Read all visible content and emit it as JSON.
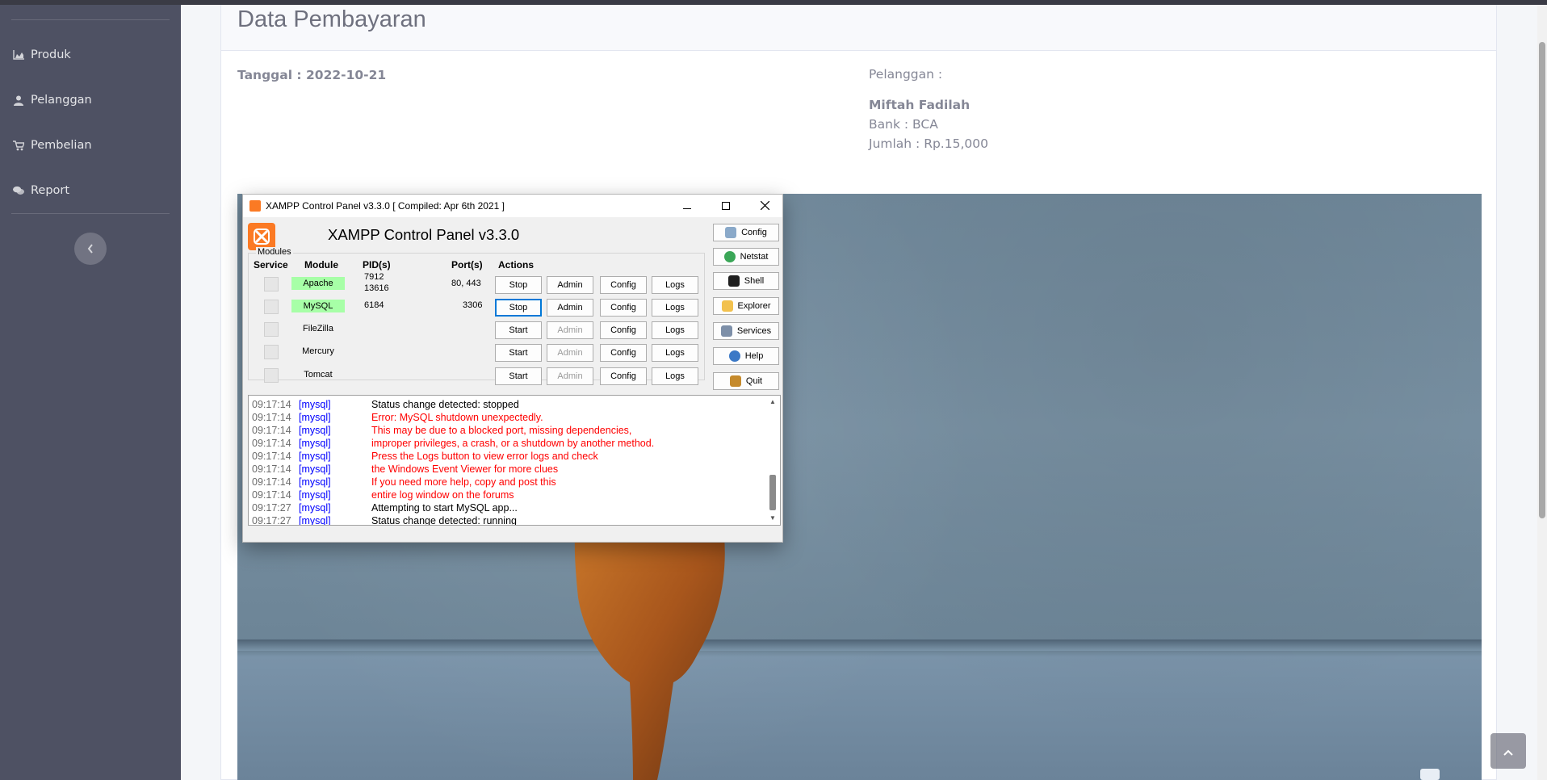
{
  "sidebar": {
    "items": [
      {
        "label": "Produk",
        "icon": "chart-area-icon"
      },
      {
        "label": "Pelanggan",
        "icon": "user-icon"
      },
      {
        "label": "Pembelian",
        "icon": "shopping-cart-icon"
      },
      {
        "label": "Report",
        "icon": "comments-icon"
      }
    ],
    "toggle_icon": "chevron-left-icon"
  },
  "page": {
    "title": "Data Pembayaran",
    "tanggal": "Tanggal : 2022-10-21",
    "customer_label": "Pelanggan :",
    "customer_name": "Miftah Fadilah",
    "bank": "Bank : BCA",
    "jumlah": "Jumlah : Rp.15,000"
  },
  "xampp": {
    "window_title": "XAMPP Control Panel v3.3.0   [ Compiled: Apr 6th 2021 ]",
    "header_title": "XAMPP Control Panel v3.3.0",
    "modules_label": "Modules",
    "columns": {
      "service": "Service",
      "module": "Module",
      "pid": "PID(s)",
      "port": "Port(s)",
      "actions": "Actions"
    },
    "modules": [
      {
        "name": "Apache",
        "pid1": "7912",
        "pid2": "13616",
        "ports": "80, 443",
        "toggle": "Stop",
        "admin": "Admin",
        "config": "Config",
        "logs": "Logs"
      },
      {
        "name": "MySQL",
        "pid1": "6184",
        "pid2": "",
        "ports": "3306",
        "toggle": "Stop",
        "admin": "Admin",
        "config": "Config",
        "logs": "Logs"
      },
      {
        "name": "FileZilla",
        "pid1": "",
        "pid2": "",
        "ports": "",
        "toggle": "Start",
        "admin": "Admin",
        "config": "Config",
        "logs": "Logs"
      },
      {
        "name": "Mercury",
        "pid1": "",
        "pid2": "",
        "ports": "",
        "toggle": "Start",
        "admin": "Admin",
        "config": "Config",
        "logs": "Logs"
      },
      {
        "name": "Tomcat",
        "pid1": "",
        "pid2": "",
        "ports": "",
        "toggle": "Start",
        "admin": "Admin",
        "config": "Config",
        "logs": "Logs"
      }
    ],
    "side_buttons": [
      "Config",
      "Netstat",
      "Shell",
      "Explorer",
      "Services",
      "Help",
      "Quit"
    ],
    "log": [
      {
        "time": "09:17:14",
        "module": "[mysql]",
        "msg": "Status change detected: stopped",
        "color": "#000000"
      },
      {
        "time": "09:17:14",
        "module": "[mysql]",
        "msg": "Error: MySQL shutdown unexpectedly.",
        "color": "#ff0000"
      },
      {
        "time": "09:17:14",
        "module": "[mysql]",
        "msg": "This may be due to a blocked port, missing dependencies,",
        "color": "#ff0000"
      },
      {
        "time": "09:17:14",
        "module": "[mysql]",
        "msg": "improper privileges, a crash, or a shutdown by another method.",
        "color": "#ff0000"
      },
      {
        "time": "09:17:14",
        "module": "[mysql]",
        "msg": "Press the Logs button to view error logs and check",
        "color": "#ff0000"
      },
      {
        "time": "09:17:14",
        "module": "[mysql]",
        "msg": "the Windows Event Viewer for more clues",
        "color": "#ff0000"
      },
      {
        "time": "09:17:14",
        "module": "[mysql]",
        "msg": "If you need more help, copy and post this",
        "color": "#ff0000"
      },
      {
        "time": "09:17:14",
        "module": "[mysql]",
        "msg": "entire log window on the forums",
        "color": "#ff0000"
      },
      {
        "time": "09:17:27",
        "module": "[mysql]",
        "msg": "Attempting to start MySQL app...",
        "color": "#000000"
      },
      {
        "time": "09:17:27",
        "module": "[mysql]",
        "msg": "Status change detected: running",
        "color": "#000000"
      }
    ]
  },
  "colors": {
    "sidebar_bg": "#4e5163",
    "running_green": "#a7ffa7",
    "xampp_orange": "#fb7a24"
  },
  "scroll_top_icon": "chevron-up-icon"
}
